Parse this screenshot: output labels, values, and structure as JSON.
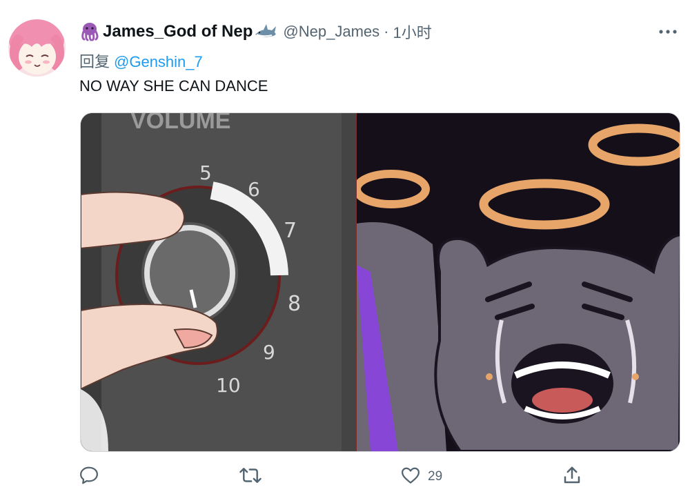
{
  "tweet": {
    "author": {
      "display_name": "James_God of Nep",
      "handle": "@Nep_James",
      "separator": "·",
      "time": "1小时"
    },
    "reply": {
      "prefix": "回复",
      "mention": "@Genshin_7"
    },
    "text": "NO WAY SHE CAN DANCE",
    "media": {
      "left_panel": {
        "label_top": "VOLUME",
        "dial_numbers": [
          "5",
          "6",
          "7",
          "8",
          "9",
          "10"
        ]
      }
    },
    "actions": {
      "reply_icon": "reply-icon",
      "retweet_icon": "retweet-icon",
      "like_icon": "like-icon",
      "like_count": "29",
      "share_icon": "share-icon"
    }
  },
  "colors": {
    "link": "#1d9bf0",
    "secondary": "#536471",
    "primary_text": "#0f1419",
    "halo": "#e8a56a",
    "creature": "#6e6775"
  }
}
